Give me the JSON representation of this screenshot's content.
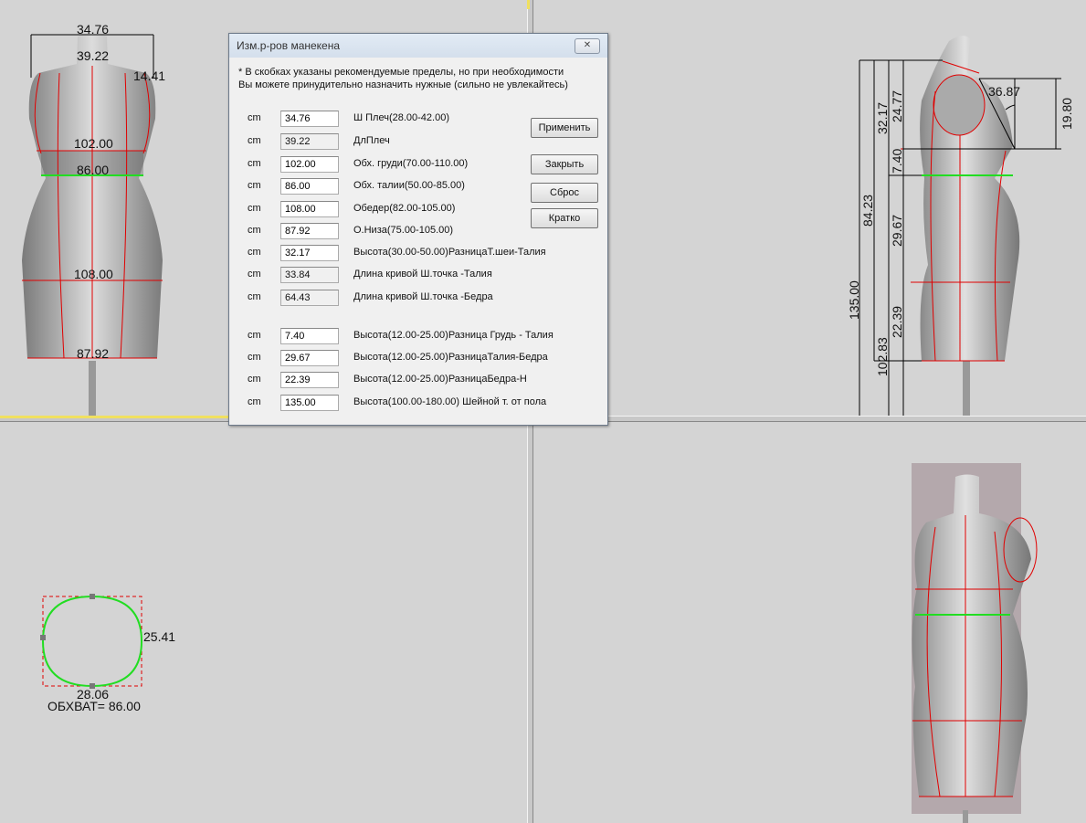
{
  "front_view": {
    "shoulder_width": "34.76",
    "shoulder_length": "39.22",
    "side": "14.41",
    "bust": "102.00",
    "waist": "86.00",
    "hips": "108.00",
    "bottom": "87.92"
  },
  "side_view": {
    "total_height": "135.00",
    "h1": "84.23",
    "h2": "32.17",
    "h3": "24.77",
    "h4": "7.40",
    "h5": "29.67",
    "h6": "22.39",
    "h7": "102.83",
    "angle": "36.87",
    "bust_depth": "19.80"
  },
  "section_view": {
    "width": "25.41",
    "depth": "28.06",
    "girth": "ОБХВАТ= 86.00"
  },
  "dialog": {
    "title": "Изм.р-ров манекена",
    "close": "✕",
    "note_line1": "*  В скобках указаны  рекомендуемые пределы,  но при необходимости",
    "note_line2": "Вы можете принудительно назначить нужные (сильно не увлекайтесь)",
    "unit": "cm",
    "fields": [
      {
        "value": "34.76",
        "label": "Ш Плеч(28.00-42.00)"
      },
      {
        "value": "39.22",
        "label": "ДлПлеч"
      },
      {
        "value": "102.00",
        "label": "Обх. груди(70.00-110.00)"
      },
      {
        "value": "86.00",
        "label": "Обх. талии(50.00-85.00)"
      },
      {
        "value": "108.00",
        "label": "Обедер(82.00-105.00)"
      },
      {
        "value": "87.92",
        "label": "О.Низа(75.00-105.00)"
      },
      {
        "value": "32.17",
        "label": "Высота(30.00-50.00)РазницаТ.шеи-Талия"
      },
      {
        "value": "33.84",
        "label": "Длина кривой Ш.точка -Талия"
      },
      {
        "value": "64.43",
        "label": "Длина кривой Ш.точка -Бедра"
      },
      {
        "value": "7.40",
        "label": "Высота(12.00-25.00)Разница Грудь - Талия"
      },
      {
        "value": "29.67",
        "label": "Высота(12.00-25.00)РазницаТалия-Бедра"
      },
      {
        "value": "22.39",
        "label": "Высота(12.00-25.00)РазницаБедра-Н"
      },
      {
        "value": "135.00",
        "label": "Высота(100.00-180.00) Шейной т. от пола"
      }
    ],
    "buttons": {
      "apply": "Применить",
      "close": "Закрыть",
      "reset": "Сброс",
      "brief": "Кратко"
    }
  }
}
